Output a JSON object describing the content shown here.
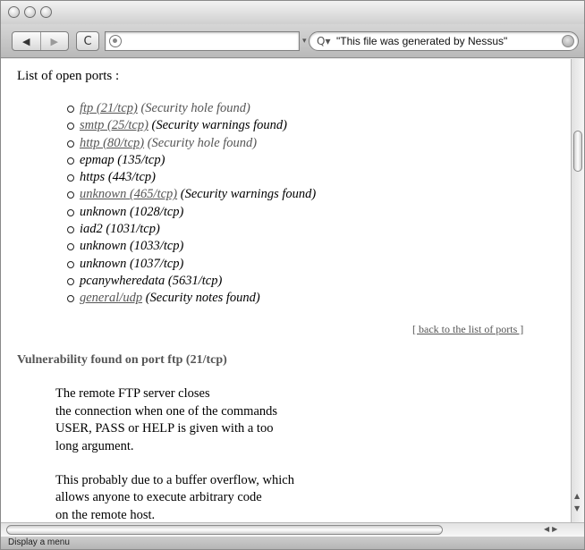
{
  "toolbar": {
    "back_glyph": "◀",
    "forward_glyph": "▶",
    "reload_glyph": "C",
    "url_value": "",
    "search_value": "\"This file was generated by Nessus\""
  },
  "content": {
    "open_ports_heading": "List of open ports :",
    "ports": [
      {
        "port": "ftp (21/tcp)",
        "status": "(Security hole found)",
        "linked": true
      },
      {
        "port": "smtp (25/tcp)",
        "status": "(Security warnings found)",
        "linked": true
      },
      {
        "port": "http (80/tcp)",
        "status": "(Security hole found)",
        "linked": true
      },
      {
        "port": "epmap (135/tcp)",
        "status": "",
        "linked": false
      },
      {
        "port": "https (443/tcp)",
        "status": "",
        "linked": false
      },
      {
        "port": "unknown (465/tcp)",
        "status": "(Security warnings found)",
        "linked": true
      },
      {
        "port": "unknown (1028/tcp)",
        "status": "",
        "linked": false
      },
      {
        "port": "iad2 (1031/tcp)",
        "status": "",
        "linked": false
      },
      {
        "port": "unknown (1033/tcp)",
        "status": "",
        "linked": false
      },
      {
        "port": "unknown (1037/tcp)",
        "status": "",
        "linked": false
      },
      {
        "port": "pcanywheredata (5631/tcp)",
        "status": "",
        "linked": false
      },
      {
        "port": "general/udp",
        "status": "(Security notes found)",
        "linked": true
      }
    ],
    "back_link": "[ back to the list of ports ]",
    "vuln_title": "Vulnerability found on port ftp (21/tcp)",
    "desc_lines": [
      "The remote FTP server closes",
      "the connection when one of the commands",
      "USER, PASS or HELP is given with a too",
      "long argument.",
      "",
      "This probably due to a buffer overflow, which",
      "allows anyone to execute arbitrary code",
      "on the remote host."
    ]
  },
  "statusbar": {
    "text": "Display a menu"
  }
}
